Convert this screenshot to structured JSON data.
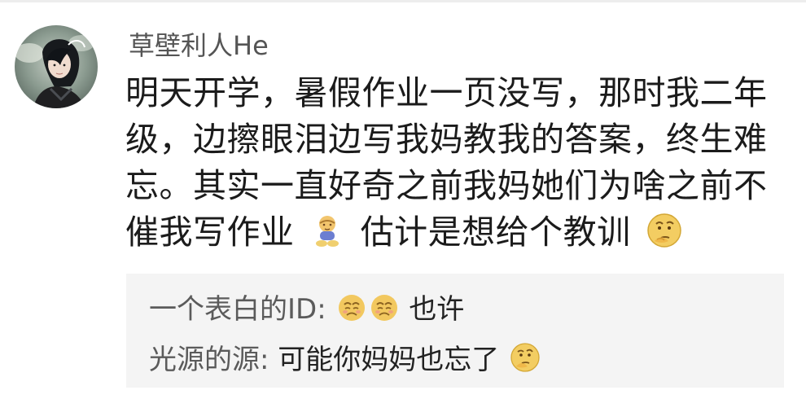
{
  "comment": {
    "username": "草壁利人He",
    "lines": [
      "明天开学，暑假作业一页没写，那时我二年",
      "级，边擦眼泪边写我妈教我的答案，终生难",
      "忘。其实一直好奇之前我妈她们为啥之前不"
    ],
    "last_line_part1": "催我写作业",
    "last_line_part2": "估计是想给个教训",
    "emoji_1": "toddler-sitting-emoji",
    "emoji_2": "thinking-face-emoji"
  },
  "replies": [
    {
      "author": "一个表白的ID",
      "separator": ":",
      "text": "也许",
      "emojis": [
        "sad-face-emoji",
        "sad-face-emoji"
      ]
    },
    {
      "author": "光源的源",
      "separator": ":",
      "text": "可能你妈妈也忘了",
      "emojis": [
        "thinking-face-emoji"
      ]
    }
  ],
  "colors": {
    "username": "#555555",
    "body_text": "#1b1b1b",
    "reply_background": "#f4f4f4",
    "reply_author": "#5b5b5b"
  }
}
